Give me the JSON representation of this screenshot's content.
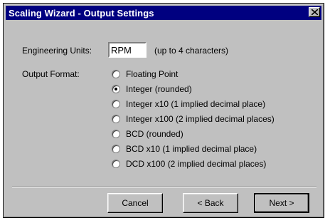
{
  "window": {
    "title": "Scaling Wizard - Output Settings"
  },
  "engineering_units": {
    "label": "Engineering Units:",
    "value": "RPM",
    "hint": "(up to 4 characters)"
  },
  "output_format": {
    "label": "Output Format:",
    "selected_index": 1,
    "options": [
      "Floating Point",
      "Integer (rounded)",
      "Integer x10 (1 implied decimal place)",
      "Integer x100 (2 implied decimal places)",
      "BCD (rounded)",
      "BCD x10 (1 implied decimal place)",
      "DCD x100 (2 implied decimal places)"
    ]
  },
  "buttons": {
    "cancel": "Cancel",
    "back": "< Back",
    "next": "Next >"
  },
  "colors": {
    "titlebar": "#000080",
    "face": "#c0c0c0"
  }
}
